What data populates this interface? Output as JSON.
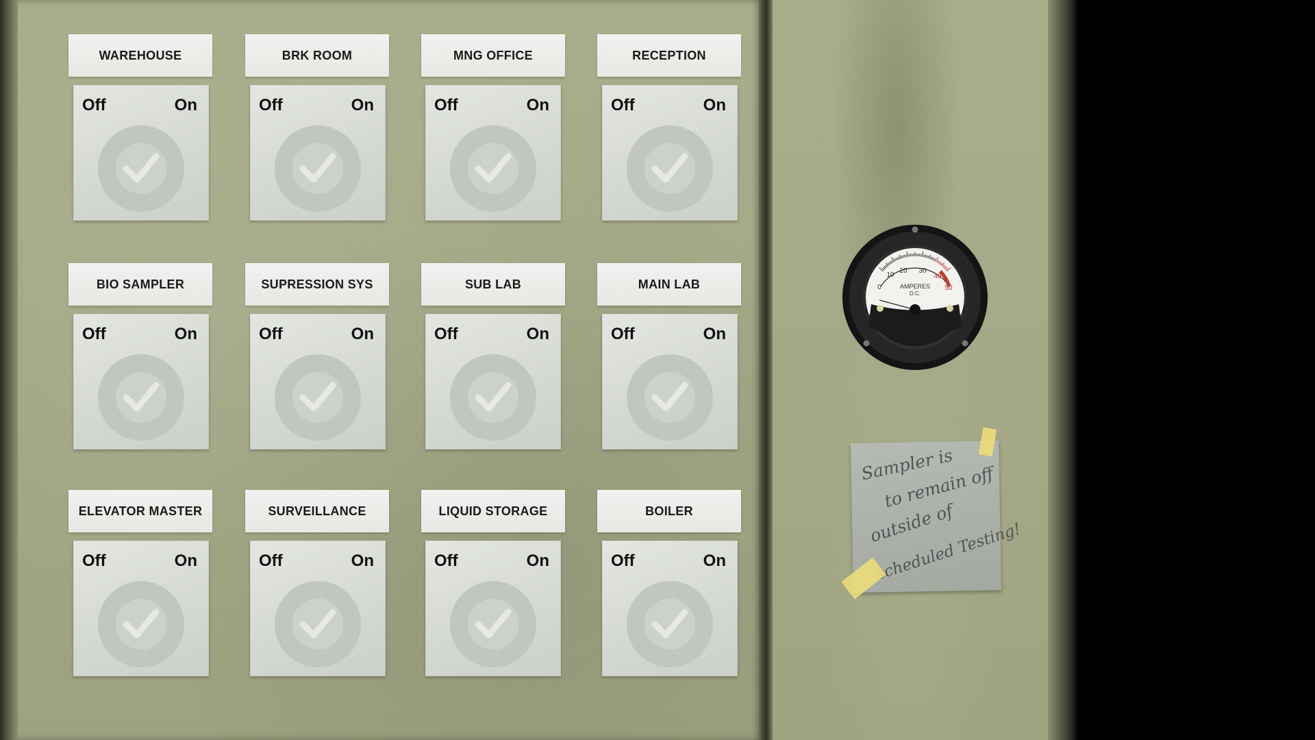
{
  "switches": [
    {
      "label": "WAREHOUSE",
      "off": "Off",
      "on": "On"
    },
    {
      "label": "BRK ROOM",
      "off": "Off",
      "on": "On"
    },
    {
      "label": "MNG OFFICE",
      "off": "Off",
      "on": "On"
    },
    {
      "label": "RECEPTION",
      "off": "Off",
      "on": "On"
    },
    {
      "label": "BIO SAMPLER",
      "off": "Off",
      "on": "On"
    },
    {
      "label": "SUPRESSION SYS",
      "off": "Off",
      "on": "On"
    },
    {
      "label": "SUB LAB",
      "off": "Off",
      "on": "On"
    },
    {
      "label": "MAIN LAB",
      "off": "Off",
      "on": "On"
    },
    {
      "label": "ELEVATOR MASTER",
      "off": "Off",
      "on": "On"
    },
    {
      "label": "SURVEILLANCE",
      "off": "Off",
      "on": "On"
    },
    {
      "label": "LIQUID STORAGE",
      "off": "Off",
      "on": "On"
    },
    {
      "label": "BOILER",
      "off": "Off",
      "on": "On"
    }
  ],
  "gauge": {
    "scale": [
      "0",
      "10",
      "20",
      "30",
      "40",
      "50"
    ],
    "unit": "AMPERES",
    "unit_sub": "D.C."
  },
  "note": {
    "lines": [
      "Sampler is",
      "to remain off",
      "outside of",
      "scheduled Testing!"
    ]
  },
  "colors": {
    "panel": "#a6aa88",
    "label_bg": "#ececea",
    "switch_bg": "#d8dbd6",
    "note_bg": "#aeb3ac",
    "tape": "#eede78",
    "gauge_red": "#c0392b"
  },
  "icons": {
    "switch_knob": "rotary-knob-icon",
    "gauge": "ammeter-gauge-icon"
  }
}
